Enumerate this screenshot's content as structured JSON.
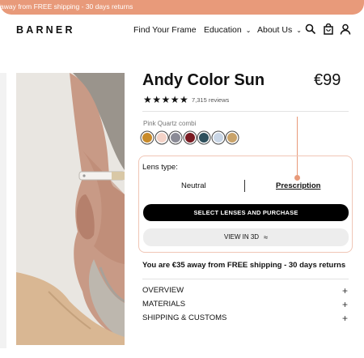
{
  "announcement": "away from FREE shipping - 30 days returns",
  "nav": {
    "logo": "BARNER",
    "items": [
      {
        "label": "Find Your Frame",
        "chevron": false
      },
      {
        "label": "Education",
        "chevron": true
      },
      {
        "label": "About Us",
        "chevron": true
      }
    ],
    "icons": [
      "search-icon",
      "bag-icon",
      "user-icon"
    ]
  },
  "product": {
    "name": "Andy Color Sun",
    "price": "€99",
    "rating_stars": "★★★★★",
    "reviews": "7,315 reviews",
    "color_label": "Pink Quartz combi",
    "swatches": [
      "#c98b2a",
      "#f4d3c8",
      "#8b8b96",
      "#7a1b22",
      "#2d4f5c",
      "#c9d6e6",
      "#c9a36a"
    ]
  },
  "lens": {
    "label": "Lens type:",
    "options": [
      "Neutral",
      "Prescription"
    ],
    "selected": "Prescription"
  },
  "buttons": {
    "purchase": "SELECT LENSES AND PURCHASE",
    "view3d": "VIEW IN 3D"
  },
  "shipping_message": "You are €35 away from FREE shipping - 30 days returns",
  "accordion": [
    "OVERVIEW",
    "MATERIALS",
    "SHIPPING & CUSTOMS"
  ],
  "colors": {
    "accent": "#e89a7a",
    "highlight_border": "#f0c6b6",
    "primary_button": "#000000",
    "secondary_button": "#ededed"
  }
}
